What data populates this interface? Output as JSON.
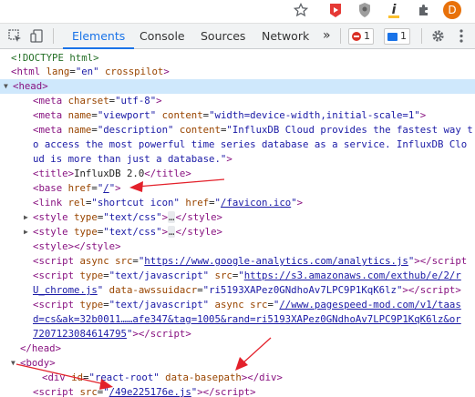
{
  "browser": {
    "extensions": [
      "star-icon",
      "media-extension-icon",
      "privacy-extension-icon",
      "i-extension-icon",
      "puzzle-icon"
    ],
    "profile_initial": "D",
    "profile_color": "#e8710a"
  },
  "devtools": {
    "tabs": [
      "Elements",
      "Console",
      "Sources",
      "Network"
    ],
    "more_label": "»",
    "errors_count": "1",
    "messages_count": "1",
    "accent_color": "#1a73e8",
    "error_color": "#d93025"
  },
  "tree": {
    "doctype": "<!DOCTYPE html>",
    "html": {
      "tag": "html",
      "lang_attr": "lang",
      "lang_val": "en",
      "extra_attr": "crosspilot"
    },
    "head_tag": "head",
    "meta_charset": {
      "tag": "meta",
      "attr": "charset",
      "val": "utf-8"
    },
    "meta_viewport": {
      "tag": "meta",
      "name_attr": "name",
      "name_val": "viewport",
      "content_attr": "content",
      "content_val": "width=device-width,initial-scale=1"
    },
    "meta_description": {
      "tag": "meta",
      "name_attr": "name",
      "name_val": "description",
      "content_attr": "content",
      "line1": "InfluxDB Cloud provides the fastest way t",
      "line2": "o access the most powerful time series database as a service. InfluxDB Clo",
      "line3": "ud is more than just a database."
    },
    "title": {
      "tag": "title",
      "text": "InfluxDB 2.0"
    },
    "base": {
      "tag": "base",
      "attr": "href",
      "val": "/"
    },
    "link": {
      "tag": "link",
      "rel_attr": "rel",
      "rel_val": "shortcut icon",
      "href_attr": "href",
      "href_val": "/favicon.ico"
    },
    "style1": {
      "tag": "style",
      "attr": "type",
      "val": "text/css"
    },
    "style2": {
      "tag": "style",
      "attr": "type",
      "val": "text/css"
    },
    "style3": {
      "tag": "style"
    },
    "script1": {
      "tag": "script",
      "attr1": "async",
      "src_attr": "src",
      "src_val": "https://www.google-analytics.com/analytics.js"
    },
    "script2": {
      "tag": "script",
      "type_attr": "type",
      "type_val": "text/javascript",
      "src_attr": "src",
      "src_line1": "https://s3.amazonaws.com/exthub/e/2/r",
      "src_line2": "U_chrome.js",
      "extra_attr": "data-awssuidacr",
      "extra_val": "ri5193XAPez0GNdhoAv7LPC9P1KqK6lz"
    },
    "script3": {
      "tag": "script",
      "type_attr": "type",
      "type_val": "text/javascript",
      "async_attr": "async",
      "src_attr": "src",
      "src_line1": "//www.pagespeed-mod.com/v1/taas",
      "src_line2": "d=cs&ak=32b0011……afe347&tag=1005&rand=ri5193XAPez0GNdhoAv7LPC9P1KqK6lz&or",
      "src_line3": "7207123084614795"
    },
    "body_tag": "body",
    "div": {
      "tag": "div",
      "id_attr": "id",
      "id_val": "react-root",
      "extra_attr": "data-basepath"
    },
    "script4": {
      "tag": "script",
      "src_attr": "src",
      "src_val": "/49e225176e.js"
    },
    "ellipsis": "…"
  }
}
